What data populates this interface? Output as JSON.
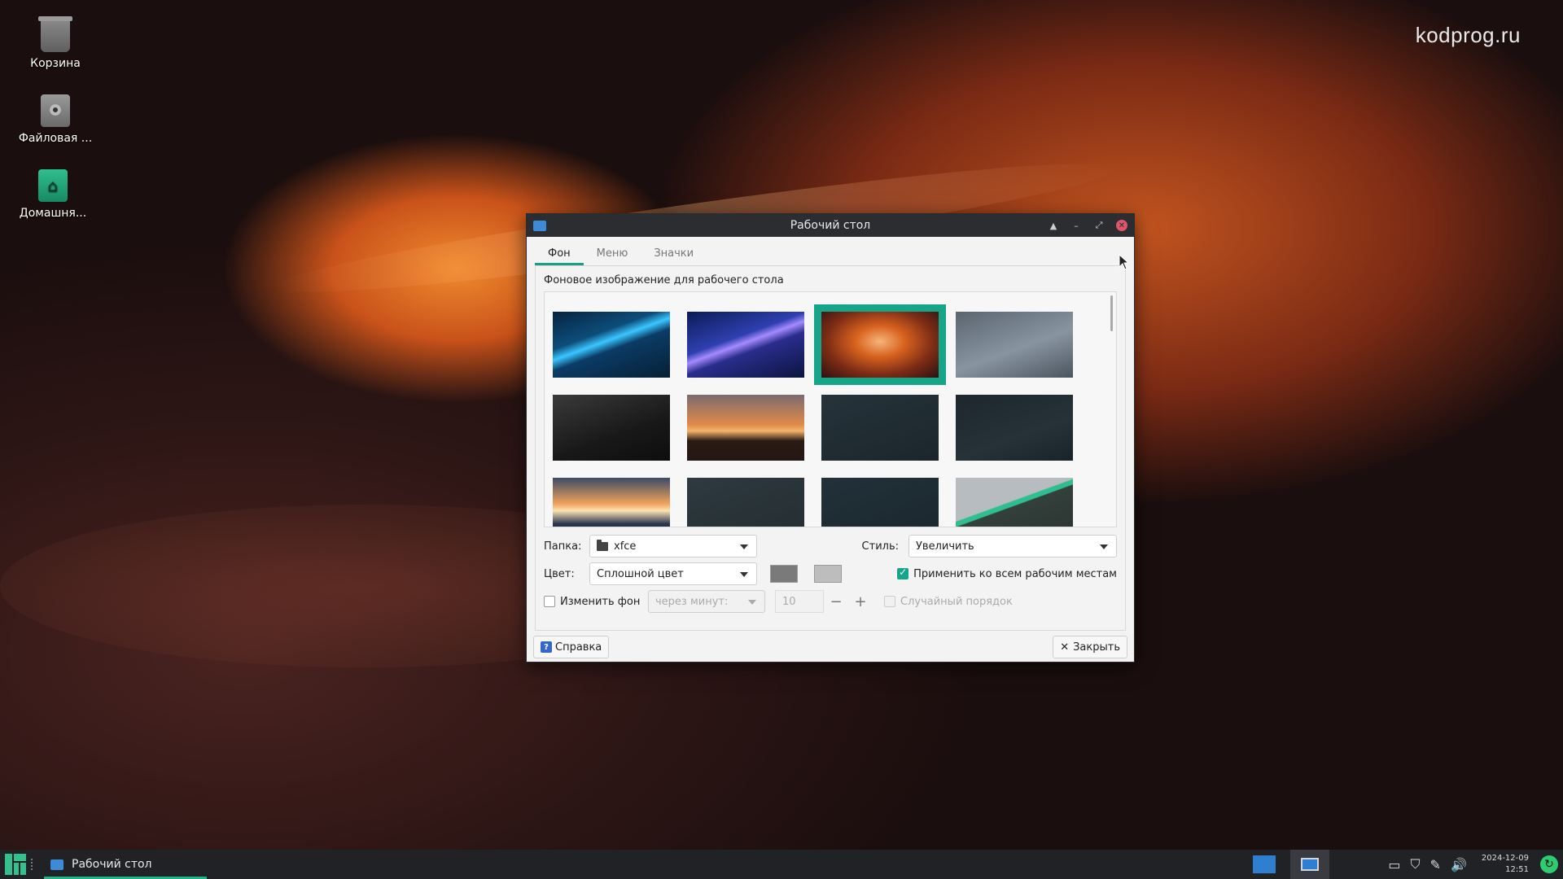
{
  "watermark": "kodprog.ru",
  "desktop": {
    "icons": [
      {
        "label": "Корзина",
        "icon": "trash-icon"
      },
      {
        "label": "Файловая ...",
        "icon": "disk-icon"
      },
      {
        "label": "Домашня...",
        "icon": "home-folder-icon"
      }
    ]
  },
  "window": {
    "title": "Рабочий стол",
    "tabs": [
      "Фон",
      "Меню",
      "Значки"
    ],
    "active_tab": "Фон",
    "section_label": "Фоновое изображение для рабочего стола",
    "folder_label": "Папка:",
    "folder_value": "xfce",
    "style_label": "Стиль:",
    "style_value": "Увеличить",
    "color_label": "Цвет:",
    "color_value": "Сплошной цвет",
    "primary_color": "#7a7a7a",
    "secondary_color": "#bdbdbd",
    "apply_all_label": "Применить ко всем рабочим местам",
    "apply_all_checked": true,
    "change_bg_label": "Изменить фон",
    "change_bg_checked": false,
    "interval_unit": "через минут:",
    "interval_value": "10",
    "random_order_label": "Случайный порядок",
    "random_order_checked": false,
    "help_label": "Справка",
    "close_label": "Закрыть",
    "accent": "#17a589"
  },
  "wallpapers": [
    {
      "name": "blue-waves",
      "selected": false
    },
    {
      "name": "purple-streak",
      "selected": false
    },
    {
      "name": "canyon",
      "selected": true
    },
    {
      "name": "manjaro-grey",
      "selected": false
    },
    {
      "name": "dark-gradient",
      "selected": false
    },
    {
      "name": "city-sunset",
      "selected": false
    },
    {
      "name": "manjaro-dark-logo",
      "selected": false
    },
    {
      "name": "dark-slate",
      "selected": false
    },
    {
      "name": "sea-sunset",
      "selected": false
    },
    {
      "name": "dark-green-mark",
      "selected": false
    },
    {
      "name": "dark-teal-square",
      "selected": false
    },
    {
      "name": "green-stripes",
      "selected": false
    }
  ],
  "taskbar": {
    "task_label": "Рабочий стол",
    "clock_date": "2024-12-09",
    "clock_time": "12:51"
  }
}
